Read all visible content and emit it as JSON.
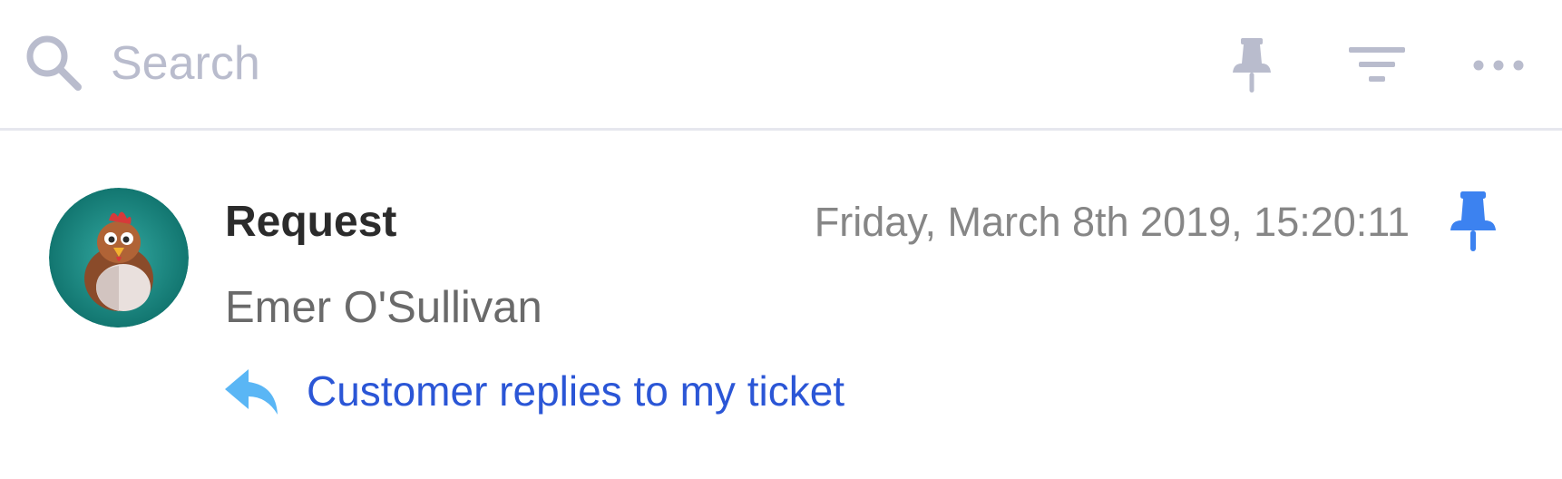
{
  "colors": {
    "muted_icon": "#b9bccd",
    "accent_blue": "#3c82f0",
    "link_blue": "#2b56d6",
    "reply_icon": "#5ab6f5",
    "avatar_bg": "#1e8a84"
  },
  "toolbar": {
    "search": {
      "placeholder": "Search",
      "value": "",
      "icon": "search-icon"
    },
    "actions": [
      {
        "name": "pin",
        "icon": "pin-icon"
      },
      {
        "name": "filter",
        "icon": "filter-icon"
      },
      {
        "name": "more",
        "icon": "more-horizontal-icon"
      }
    ]
  },
  "items": [
    {
      "avatar_icon": "chicken-avatar",
      "title": "Request",
      "timestamp": "Friday, March 8th 2019, 15:20:11",
      "pinned": true,
      "name": "Emer O'Sullivan",
      "event": {
        "icon": "reply-icon",
        "text": "Customer replies to my ticket"
      }
    }
  ]
}
